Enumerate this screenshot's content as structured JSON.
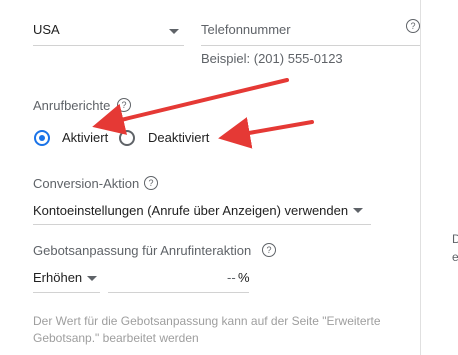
{
  "country": {
    "value": "USA"
  },
  "phone": {
    "placeholder": "Telefonnummer",
    "example": "Beispiel: (201) 555-0123",
    "help_icon": "help-circle-icon"
  },
  "call_reports": {
    "label": "Anrufberichte",
    "options": [
      {
        "label": "Aktiviert",
        "selected": true
      },
      {
        "label": "Deaktiviert",
        "selected": false
      }
    ]
  },
  "conversion_action": {
    "label": "Conversion-Aktion",
    "value": "Kontoeinstellungen (Anrufe über Anzeigen) verwenden"
  },
  "bid_adjustment": {
    "label": "Gebotsanpassung für Anrufinteraktion",
    "mode": "Erhöhen",
    "value": "--",
    "unit": "%"
  },
  "footer_note": "Der Wert für die Gebotsanpassung kann auf der Seite \"Erweiterte Gebotsanp.\" bearbeitet werden",
  "side_text": [
    "D",
    "e"
  ],
  "annotation": {
    "arrow_color": "#e53935"
  },
  "colors": {
    "accent": "#1a73e8"
  }
}
